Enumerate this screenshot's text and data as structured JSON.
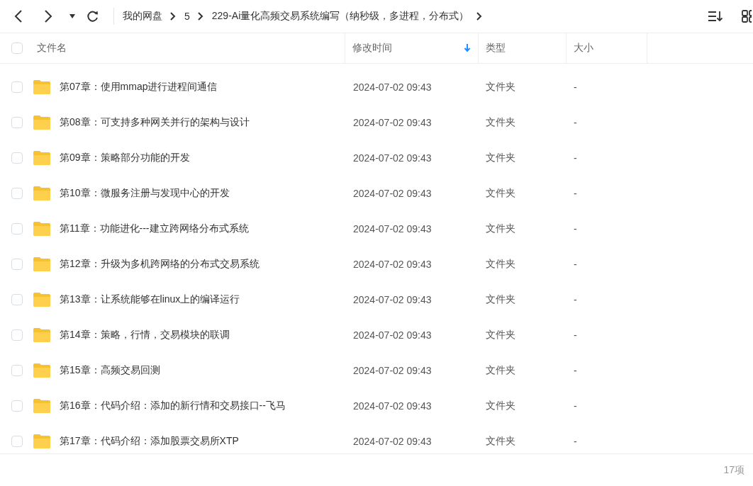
{
  "breadcrumb": [
    "我的网盘",
    "5",
    "229-Ai量化高频交易系统编写（纳秒级，多进程，分布式）"
  ],
  "columns": [
    {
      "label": "文件名",
      "sorted": false
    },
    {
      "label": "修改时间",
      "sorted": true
    },
    {
      "label": "类型",
      "sorted": false
    },
    {
      "label": "大小",
      "sorted": false
    }
  ],
  "rows": [
    {
      "name": "第07章：使用mmap进行进程间通信",
      "modified": "2024-07-02 09:43",
      "type": "文件夹",
      "size": "-",
      "checked": false
    },
    {
      "name": "第08章：可支持多种网关并行的架构与设计",
      "modified": "2024-07-02 09:43",
      "type": "文件夹",
      "size": "-",
      "checked": false
    },
    {
      "name": "第09章：策略部分功能的开发",
      "modified": "2024-07-02 09:43",
      "type": "文件夹",
      "size": "-",
      "checked": false
    },
    {
      "name": "第10章：微服务注册与发现中心的开发",
      "modified": "2024-07-02 09:43",
      "type": "文件夹",
      "size": "-",
      "checked": false
    },
    {
      "name": "第11章：功能进化---建立跨网络分布式系统",
      "modified": "2024-07-02 09:43",
      "type": "文件夹",
      "size": "-",
      "checked": false
    },
    {
      "name": "第12章：升级为多机跨网络的分布式交易系统",
      "modified": "2024-07-02 09:43",
      "type": "文件夹",
      "size": "-",
      "checked": false
    },
    {
      "name": "第13章：让系统能够在linux上的编译运行",
      "modified": "2024-07-02 09:43",
      "type": "文件夹",
      "size": "-",
      "checked": false
    },
    {
      "name": "第14章：策略，行情，交易模块的联调",
      "modified": "2024-07-02 09:43",
      "type": "文件夹",
      "size": "-",
      "checked": false
    },
    {
      "name": "第15章：高频交易回测",
      "modified": "2024-07-02 09:43",
      "type": "文件夹",
      "size": "-",
      "checked": false
    },
    {
      "name": "第16章：代码介绍：添加的新行情和交易接口--飞马",
      "modified": "2024-07-02 09:43",
      "type": "文件夹",
      "size": "-",
      "checked": false
    },
    {
      "name": "第17章：代码介绍：添加股票交易所XTP",
      "modified": "2024-07-02 09:43",
      "type": "文件夹",
      "size": "-",
      "checked": false
    }
  ],
  "select_all": {
    "checked": false
  },
  "footer": {
    "count": "17项"
  }
}
